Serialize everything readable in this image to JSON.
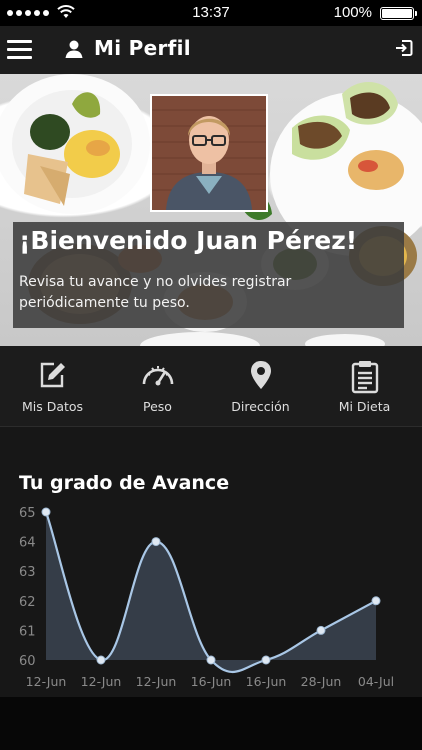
{
  "status_bar": {
    "time": "13:37",
    "battery": "100%"
  },
  "nav": {
    "title": "Mi Perfil"
  },
  "hero": {
    "welcome_title": "¡Bienvenido Juan Pérez!",
    "welcome_text": "Revisa tu avance y no olvides registrar periódicamente tu peso."
  },
  "menu": [
    {
      "label": "Mis Datos",
      "icon": "edit-icon"
    },
    {
      "label": "Peso",
      "icon": "speedometer-icon"
    },
    {
      "label": "Dirección",
      "icon": "location-pin-icon"
    },
    {
      "label": "Mi Dieta",
      "icon": "clipboard-icon"
    }
  ],
  "chart_data": {
    "type": "area",
    "title": "Tu grado de Avance",
    "categories": [
      "12-Jun",
      "12-Jun",
      "12-Jun",
      "16-Jun",
      "16-Jun",
      "28-Jun",
      "04-Jul"
    ],
    "values": [
      65,
      60,
      64,
      60,
      60,
      61,
      62
    ],
    "ylim": [
      60,
      65
    ],
    "yticks": [
      65,
      64,
      63,
      62,
      61,
      60
    ],
    "grid": false,
    "legend": "none",
    "colors": {
      "line": "#a9c7e6",
      "fill": "#3b4451",
      "point": "#dfe8f2"
    }
  }
}
